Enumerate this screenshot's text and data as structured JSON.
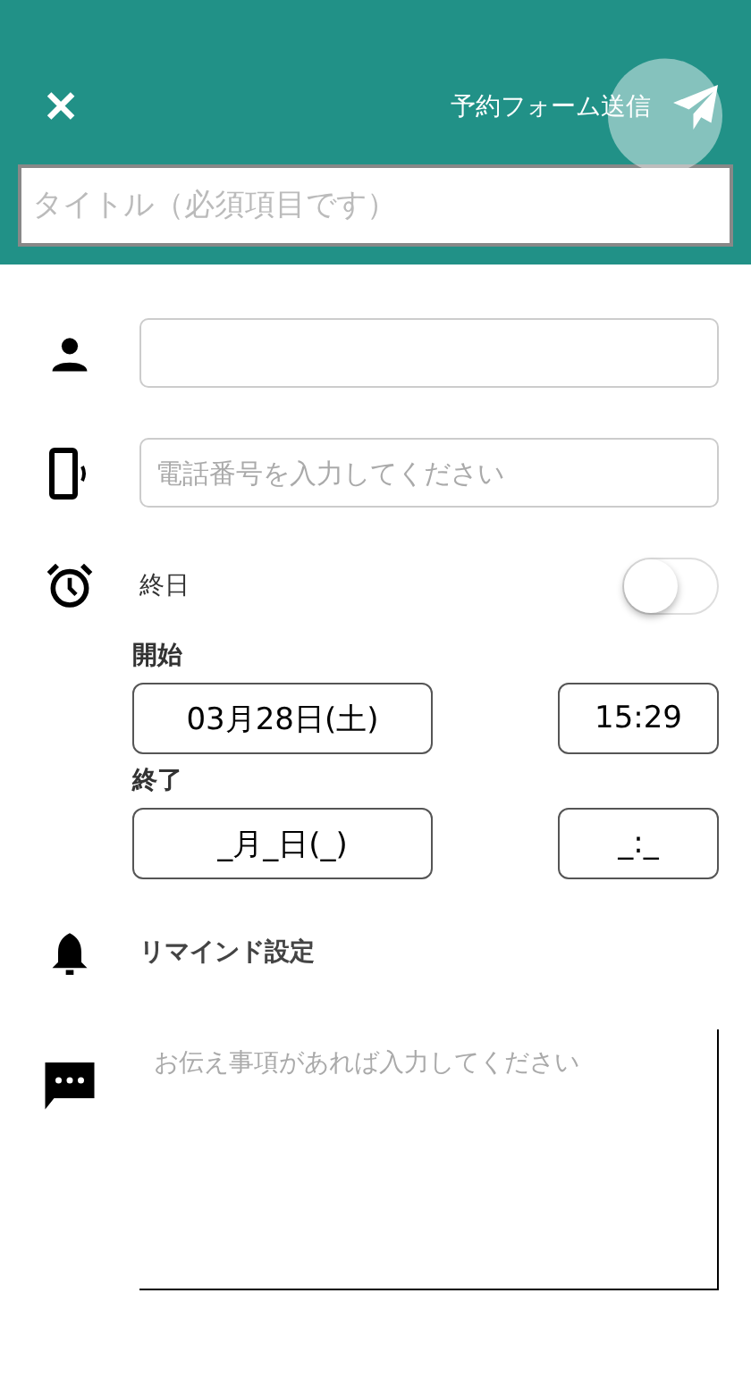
{
  "header": {
    "close": "✕",
    "send_label": "予約フォーム送信",
    "title_placeholder": "タイトル（必須項目です）"
  },
  "phone_field": {
    "placeholder": "電話番号を入力してください"
  },
  "all_day": {
    "label": "終日",
    "on": false
  },
  "start": {
    "label": "開始",
    "date": "03月28日(土)",
    "time": "15:29"
  },
  "end": {
    "label": "終了",
    "date": "_月_日(_)",
    "time": "_:_"
  },
  "reminder": {
    "label": "リマインド設定"
  },
  "memo": {
    "placeholder": "お伝え事項があれば入力してください"
  }
}
